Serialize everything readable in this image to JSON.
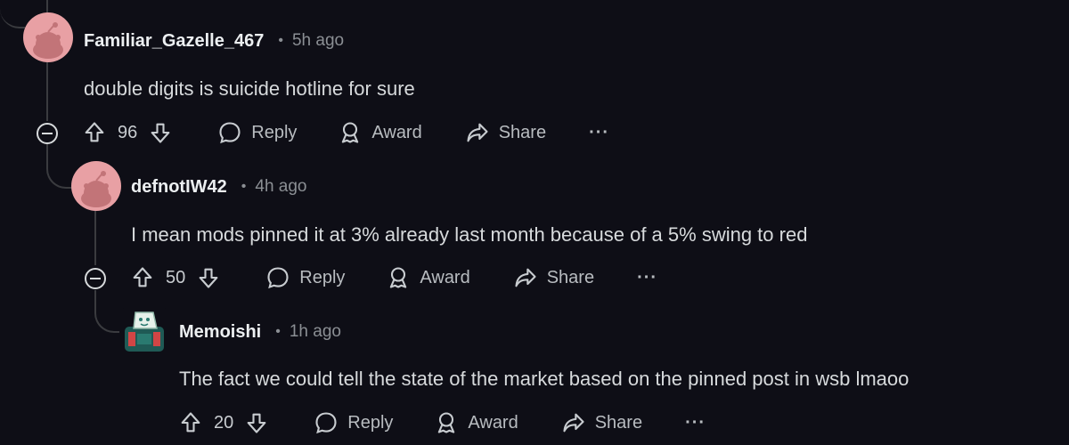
{
  "comments": [
    {
      "username": "Familiar_Gazelle_467",
      "time": "5h ago",
      "text": "double digits is suicide hotline for sure",
      "votes": "96",
      "reply_label": "Reply",
      "award_label": "Award",
      "share_label": "Share",
      "more_label": "···"
    },
    {
      "username": "defnotIW42",
      "time": "4h ago",
      "text": "I mean mods pinned it at 3% already last month because of a 5% swing to red",
      "votes": "50",
      "reply_label": "Reply",
      "award_label": "Award",
      "share_label": "Share",
      "more_label": "···"
    },
    {
      "username": "Memoishi",
      "time": "1h ago",
      "text": "The fact we could tell the state of the market based on the pinned post in wsb lmaoo",
      "votes": "20",
      "reply_label": "Reply",
      "award_label": "Award",
      "share_label": "Share",
      "more_label": "···"
    }
  ],
  "colors": {
    "background": "#0e0e16",
    "avatar_pink": "#e8a0a4",
    "thread_line": "#3a3b3f"
  },
  "icons": [
    "upvote-icon",
    "downvote-icon",
    "reply-bubble-icon",
    "award-icon",
    "share-arrow-icon",
    "collapse-minus-icon"
  ]
}
